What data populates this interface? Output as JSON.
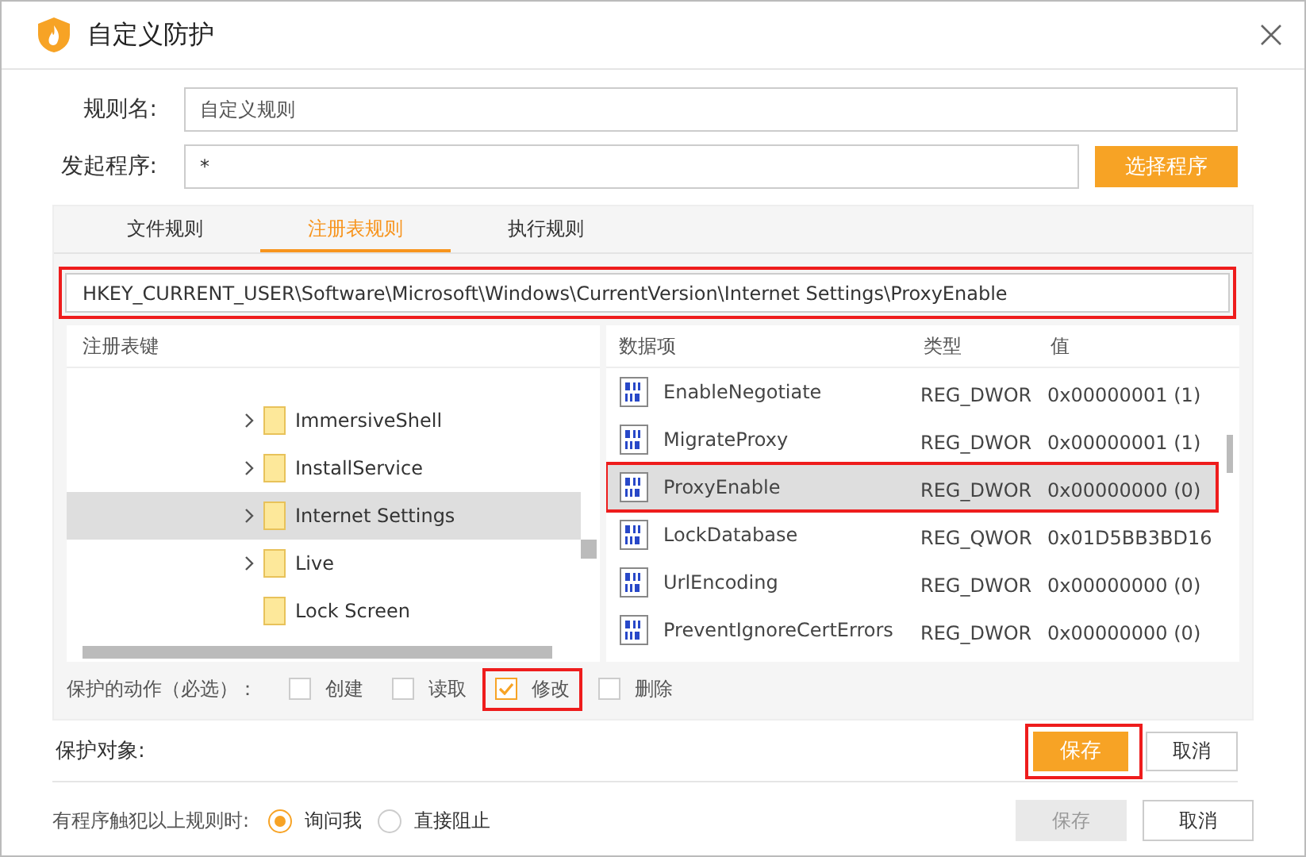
{
  "window": {
    "title": "自定义防护"
  },
  "rule_name": {
    "label": "规则名:",
    "value": "自定义规则"
  },
  "program": {
    "label": "发起程序:",
    "value": "*",
    "button": "选择程序"
  },
  "tabs": [
    {
      "label": "文件规则",
      "selected": false
    },
    {
      "label": "注册表规则",
      "selected": true
    },
    {
      "label": "执行规则",
      "selected": false
    }
  ],
  "registry_path": {
    "value": "HKEY_CURRENT_USER\\Software\\Microsoft\\Windows\\CurrentVersion\\Internet Settings\\ProxyEnable",
    "highlighted": true
  },
  "key_tree": {
    "header": "注册表键",
    "items": [
      {
        "label": "ImmersiveShell",
        "expandable": true,
        "selected": false
      },
      {
        "label": "InstallService",
        "expandable": true,
        "selected": false
      },
      {
        "label": "Internet Settings",
        "expandable": true,
        "selected": true
      },
      {
        "label": "Live",
        "expandable": true,
        "selected": false
      },
      {
        "label": "Lock Screen",
        "expandable": false,
        "selected": false
      }
    ]
  },
  "values_table": {
    "columns": [
      "数据项",
      "类型",
      "值"
    ],
    "rows": [
      {
        "name": "EnableNegotiate",
        "type": "REG_DWOR",
        "value": "0x00000001 (1)",
        "selected": false,
        "highlighted": false
      },
      {
        "name": "MigrateProxy",
        "type": "REG_DWOR",
        "value": "0x00000001 (1)",
        "selected": false,
        "highlighted": false
      },
      {
        "name": "ProxyEnable",
        "type": "REG_DWOR",
        "value": "0x00000000 (0)",
        "selected": true,
        "highlighted": true
      },
      {
        "name": "LockDatabase",
        "type": "REG_QWOR",
        "value": "0x01D5BB3BD16",
        "selected": false,
        "highlighted": false
      },
      {
        "name": "UrlEncoding",
        "type": "REG_DWOR",
        "value": "0x00000000 (0)",
        "selected": false,
        "highlighted": false
      },
      {
        "name": "PreventIgnoreCertErrors",
        "type": "REG_DWOR",
        "value": "0x00000000 (0)",
        "selected": false,
        "highlighted": false
      }
    ]
  },
  "actions": {
    "label": "保护的动作（必选）：",
    "items": [
      {
        "label": "创建",
        "checked": false,
        "highlighted": false
      },
      {
        "label": "读取",
        "checked": false,
        "highlighted": false
      },
      {
        "label": "修改",
        "checked": true,
        "highlighted": true
      },
      {
        "label": "删除",
        "checked": false,
        "highlighted": false
      }
    ]
  },
  "protect_target": {
    "label": "保护对象:",
    "save": "保存",
    "save_highlighted": true,
    "cancel": "取消"
  },
  "on_violation": {
    "label": "有程序触犯以上规则时:",
    "options": [
      {
        "label": "询问我",
        "selected": true
      },
      {
        "label": "直接阻止",
        "selected": false
      }
    ]
  },
  "footer": {
    "save": "保存",
    "save_disabled": true,
    "cancel": "取消"
  }
}
